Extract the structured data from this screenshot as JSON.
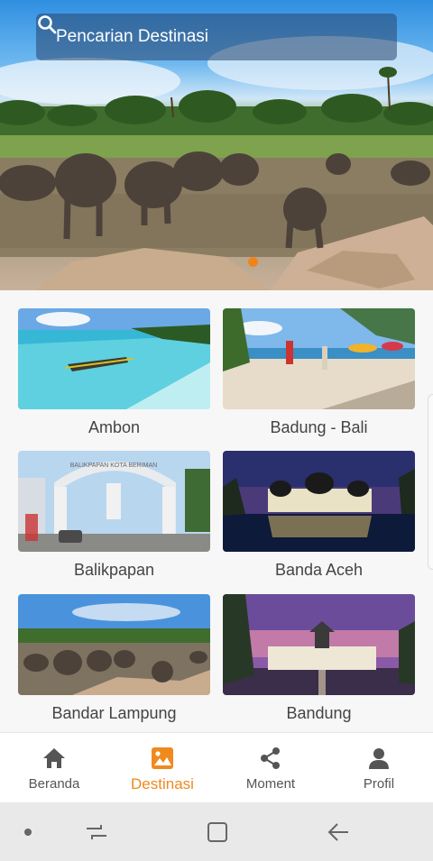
{
  "search": {
    "placeholder": "Pencarian Destinasi"
  },
  "carousel": {
    "pages": 1,
    "active_index": 0,
    "active_color": "#f0841c"
  },
  "destinations": [
    {
      "name": "Ambon"
    },
    {
      "name": "Badung - Bali"
    },
    {
      "name": "Balikpapan"
    },
    {
      "name": "Banda Aceh"
    },
    {
      "name": "Bandar Lampung"
    },
    {
      "name": "Bandung"
    }
  ],
  "gate_sign": "BALIKPAPAN KOTA BERIMAN",
  "bottom_nav": {
    "active": "Destinasi",
    "active_color": "#ef8a1e",
    "items": [
      {
        "label": "Beranda",
        "icon": "home-icon"
      },
      {
        "label": "Destinasi",
        "icon": "image-icon"
      },
      {
        "label": "Moment",
        "icon": "share-icon"
      },
      {
        "label": "Profil",
        "icon": "person-icon"
      }
    ]
  },
  "system_nav": [
    "dot-icon",
    "recents-icon",
    "home-square-icon",
    "back-icon"
  ]
}
